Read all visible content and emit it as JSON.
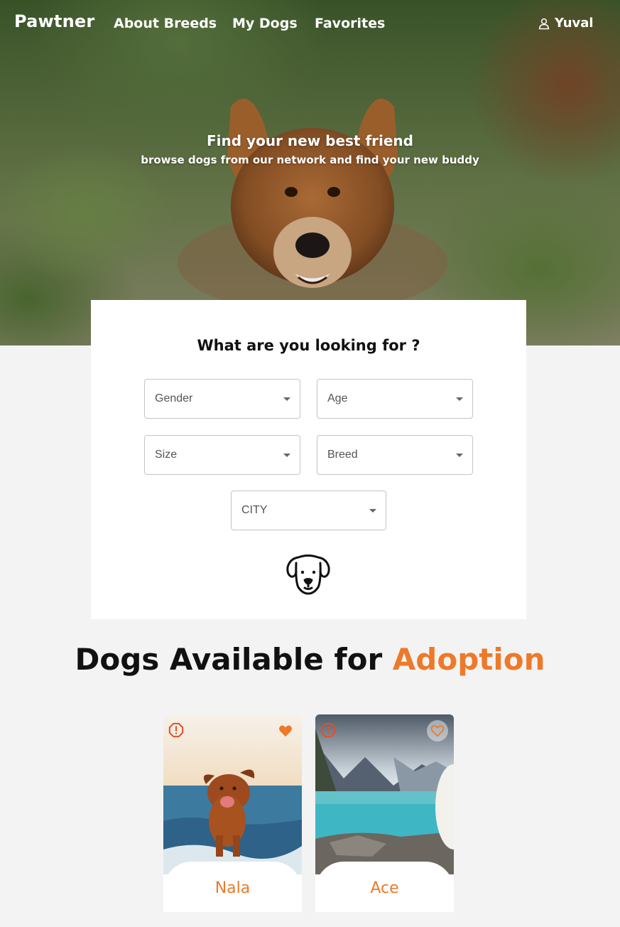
{
  "app": {
    "brand": "Pawtner"
  },
  "nav": {
    "links": [
      "About Breeds",
      "My Dogs",
      "Favorites"
    ],
    "user_name": "Yuval"
  },
  "hero": {
    "title": "Find your new best friend",
    "subtitle": "browse dogs from our network and find your new buddy"
  },
  "search": {
    "title": "What are you looking for ?",
    "filters": {
      "gender": "Gender",
      "age": "Age",
      "size": "Size",
      "breed": "Breed",
      "city": "CITY"
    }
  },
  "listing": {
    "title_prefix": "Dogs Available for ",
    "title_accent": "Adoption",
    "dogs": [
      {
        "name": "Nala",
        "favorited": true
      },
      {
        "name": "Ace",
        "favorited": false
      }
    ]
  },
  "colors": {
    "accent": "#ec7a2a",
    "report": "#e0502a"
  }
}
